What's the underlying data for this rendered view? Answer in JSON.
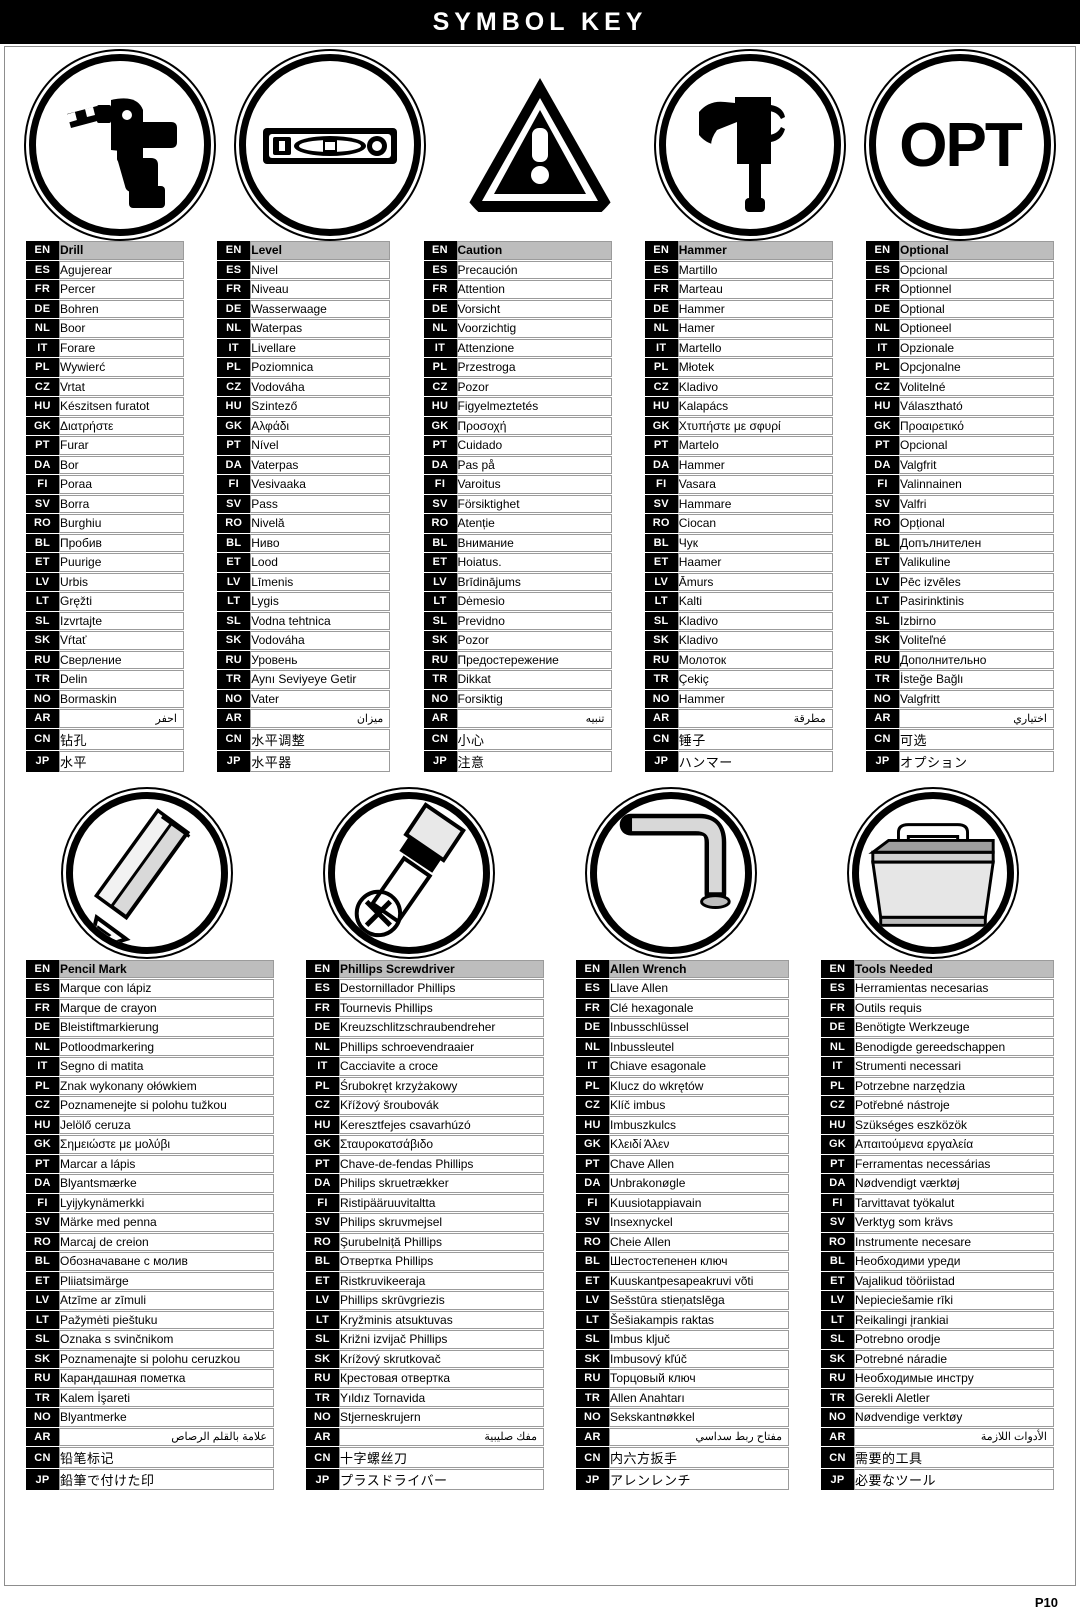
{
  "header": {
    "title": "SYMBOL KEY"
  },
  "footer": {
    "page": "P10"
  },
  "icons": {
    "drill": "drill-icon",
    "level": "level-icon",
    "caution": "caution-triangle-icon",
    "hammer": "hammer-icon",
    "optional": "opt-text-icon",
    "pencil": "pencil-icon",
    "phillips": "phillips-screwdriver-icon",
    "allen": "allen-wrench-icon",
    "tools": "toolbox-icon",
    "opt_label": "OPT"
  },
  "codes": [
    "EN",
    "ES",
    "FR",
    "DE",
    "NL",
    "IT",
    "PL",
    "CZ",
    "HU",
    "GK",
    "PT",
    "DA",
    "FI",
    "SV",
    "RO",
    "BL",
    "ET",
    "LV",
    "LT",
    "SL",
    "SK",
    "RU",
    "TR",
    "NO",
    "AR",
    "CN",
    "JP"
  ],
  "tables": [
    {
      "id": "drill",
      "title": "Drill",
      "terms": [
        "Drill",
        "Agujerear",
        "Percer",
        "Bohren",
        "Boor",
        "Forare",
        "Wywierć",
        "Vrtat",
        "Készitsen furatot",
        "Διατρήστε",
        "Furar",
        "Bor",
        "Poraa",
        "Borra",
        "Burghiu",
        "Пробив",
        "Puurige",
        "Urbis",
        "Gręžti",
        "Izvrtajte",
        "Vŕtať",
        "Сверление",
        "Delin",
        "Bormaskin",
        "احفر",
        "钻孔",
        "水平"
      ]
    },
    {
      "id": "level",
      "title": "Level",
      "terms": [
        "Level",
        "Nivel",
        "Niveau",
        "Wasserwaage",
        "Waterpas",
        "Livellare",
        "Poziomnica",
        "Vodováha",
        "Szintező",
        "Αλφάδι",
        "Nível",
        "Vaterpas",
        "Vesivaaka",
        "Pass",
        "Nivelă",
        "Ниво",
        "Lood",
        "Līmenis",
        "Lygis",
        "Vodna tehtnica",
        "Vodováha",
        "Уровень",
        "Aynı Seviyeye Getir",
        "Vater",
        "ميزان",
        "水平调整",
        "水平器"
      ]
    },
    {
      "id": "caution",
      "title": "Caution",
      "terms": [
        "Caution",
        "Precaución",
        "Attention",
        "Vorsicht",
        "Voorzichtig",
        "Attenzione",
        "Przestroga",
        "Pozor",
        "Figyelmeztetés",
        "Προσοχή",
        "Cuidado",
        "Pas på",
        "Varoitus",
        "Försiktighet",
        "Atenție",
        "Внимание",
        "Hoiatus.",
        "Brīdinājums",
        "Dėmesio",
        "Previdno",
        "Pozor",
        "Предостережение",
        "Dikkat",
        "Forsiktig",
        "تنبيه",
        "小心",
        "注意"
      ]
    },
    {
      "id": "hammer",
      "title": "Hammer",
      "terms": [
        "Hammer",
        "Martillo",
        "Marteau",
        "Hammer",
        "Hamer",
        "Martello",
        "Młotek",
        "Kladivo",
        "Kalapács",
        "Χτυπήστε με σφυρί",
        "Martelo",
        "Hammer",
        "Vasara",
        "Hammare",
        "Ciocan",
        "Чук",
        "Haamer",
        "Āmurs",
        "Kalti",
        "Kladivo",
        "Kladivo",
        "Молоток",
        "Çekiç",
        "Hammer",
        "مطرقة",
        "锤子",
        "ハンマー"
      ]
    },
    {
      "id": "optional",
      "title": "Optional",
      "terms": [
        "Optional",
        "Opcional",
        "Optionnel",
        "Optional",
        "Optioneel",
        "Opzionale",
        "Opcjonalne",
        "Volitelné",
        "Választható",
        "Προαιρετικό",
        "Opcional",
        "Valgfrit",
        "Valinnainen",
        "Valfri",
        "Opțional",
        "Допълнителен",
        "Valikuline",
        "Pēc izvēles",
        "Pasirinktinis",
        "Izbirno",
        "Voliteľné",
        "Дополнительно",
        "İsteğe Bağlı",
        "Valgfritt",
        "اختياري",
        "可选",
        "オプション"
      ]
    },
    {
      "id": "pencil",
      "title": "Pencil Mark",
      "terms": [
        "Pencil Mark",
        "Marque con lápiz",
        "Marque de crayon",
        "Bleistiftmarkierung",
        "Potloodmarkering",
        "Segno di matita",
        "Znak wykonany ołówkiem",
        "Poznamenejte si polohu tužkou",
        "Jelölő ceruza",
        "Σημειώστε με μολύβι",
        "Marcar a lápis",
        "Blyantsmærke",
        "Lyijykynämerkki",
        "Märke med penna",
        "Marcaj de creion",
        "Обозначаване с молив",
        "Pliiatsimärge",
        "Atzīme ar zīmuli",
        "Pažymėti pieštuku",
        "Oznaka s svinčnikom",
        "Poznamenajte si polohu ceruzkou",
        "Карандашная пометка",
        "Kalem İşareti",
        "Blyantmerke",
        "علامة بالقلم الرصاص",
        "铅笔标记",
        "鉛筆で付けた印"
      ]
    },
    {
      "id": "phillips",
      "title": "Phillips Screwdriver",
      "terms": [
        "Phillips Screwdriver",
        "Destornillador Phillips",
        "Tournevis Phillips",
        "Kreuzschlitzschraubendreher",
        "Phillips schroevendraaier",
        "Cacciavite a croce",
        "Śrubokręt krzyżakowy",
        "Křížový šroubovák",
        "Keresztfejes csavarhúzó",
        "Σταυροκατσάβιδο",
        "Chave-de-fendas Phillips",
        "Philips skruetrækker",
        "Ristipääruuvitaltta",
        "Philips skruvmejsel",
        "Şurubelniță Phillips",
        "Отвертка Phillips",
        "Ristkruvikeeraja",
        "Phillips skrūvgriezis",
        "Kryžminis atsuktuvas",
        "Križni izvijač Phillips",
        "Krížový skrutkovač",
        "Крестовая отвертка",
        "Yıldız Tornavida",
        "Stjerneskrujern",
        "مفك صليبية",
        "十字螺丝刀",
        "プラスドライバー"
      ]
    },
    {
      "id": "allen",
      "title": "Allen Wrench",
      "terms": [
        "Allen Wrench",
        "Llave Allen",
        "Clé hexagonale",
        "Inbusschlüssel",
        "Inbussleutel",
        "Chiave esagonale",
        "Klucz do wkrętów",
        "Klíč imbus",
        "Imbuszkulcs",
        "Κλειδί Άλεν",
        "Chave Allen",
        "Unbrakonøgle",
        "Kuusiotappiavain",
        "Insexnyckel",
        "Cheie Allen",
        "Шестостепенен ключ",
        "Kuuskantpesapeakruvi võti",
        "Sešstūra stieņatslēga",
        "Šešiakampis raktas",
        "Imbus ključ",
        "Imbusový kľúč",
        "Торцовый ключ",
        "Allen Anahtarı",
        "Sekskantnøkkel",
        "مفتاح ربط سداسي",
        "内六方扳手",
        "アレンレンチ"
      ]
    },
    {
      "id": "tools",
      "title": "Tools Needed",
      "terms": [
        "Tools Needed",
        "Herramientas necesarias",
        "Outils requis",
        "Benötigte Werkzeuge",
        "Benodigde gereedschappen",
        "Strumenti necessari",
        "Potrzebne narzędzia",
        "Potřebné nástroje",
        "Szükséges eszközök",
        "Απαιτούμενα εργαλεία",
        "Ferramentas necessárias",
        "Nødvendigt værktøj",
        "Tarvittavat työkalut",
        "Verktyg som krävs",
        "Instrumente necesare",
        "Необходими уреди",
        "Vajalikud tööriistad",
        "Nepieciešamie rīki",
        "Reikalingi įrankiai",
        "Potrebno orodje",
        "Potrebné náradie",
        "Необходимые инстру",
        "Gerekli Aletler",
        "Nødvendige verktøy",
        "الأدوات اللازمة",
        "需要的工具",
        "必要なツール"
      ]
    }
  ]
}
